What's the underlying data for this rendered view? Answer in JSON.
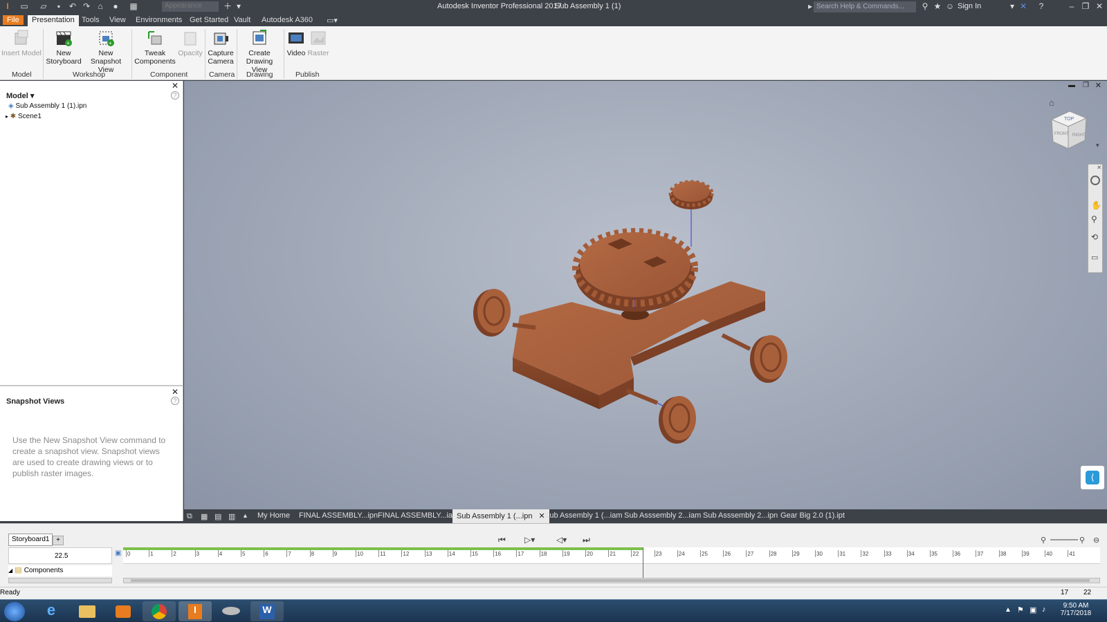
{
  "titlebar": {
    "app_title": "Autodesk Inventor Professional 2017",
    "doc_title": "Sub Assembly 1 (1)",
    "appearance": "Appearance",
    "search_placeholder": "Search Help & Commands...",
    "sign_in": "Sign In"
  },
  "menu": {
    "file": "File",
    "tabs": [
      "Presentation",
      "Tools",
      "View",
      "Environments",
      "Get Started",
      "Vault",
      "Autodesk A360"
    ]
  },
  "ribbon": {
    "buttons": [
      {
        "label1": "Insert Model",
        "label2": ""
      },
      {
        "label1": "New",
        "label2": "Storyboard"
      },
      {
        "label1": "New",
        "label2": "Snapshot View"
      },
      {
        "label1": "Tweak",
        "label2": "Components"
      },
      {
        "label1": "Opacity",
        "label2": ""
      },
      {
        "label1": "Capture",
        "label2": "Camera"
      },
      {
        "label1": "Create",
        "label2": "Drawing View"
      },
      {
        "label1": "Video",
        "label2": ""
      },
      {
        "label1": "Raster",
        "label2": ""
      }
    ],
    "groups": [
      "Model",
      "Workshop",
      "Component",
      "Camera",
      "Drawing",
      "Publish"
    ]
  },
  "model_panel": {
    "title": "Model",
    "items": [
      "Sub Assembly 1 (1).ipn",
      "Scene1"
    ]
  },
  "snapshot_panel": {
    "title": "Snapshot Views",
    "hint": "Use the New Snapshot View command to create a snapshot view. Snapshot views are used to create drawing views or to publish raster images."
  },
  "viewcube": {
    "face_top": "TOP",
    "face_front": "FRONT",
    "face_right": "RIGHT"
  },
  "doc_tabs": [
    "My Home",
    "FINAL ASSEMBLY...ipn",
    "FINAL ASSEMBLY...iam",
    "Sub Assembly 1 (...ipn",
    "Sub Assembly 1 (...iam",
    "Sub Asssembly 2...iam",
    "Sub Asssembly 2...ipn",
    "Gear Big 2.0 (1).ipt"
  ],
  "storyboard": {
    "tab": "Storyboard1",
    "time": "22.5",
    "track": "Components",
    "ticks": [
      "0",
      "1",
      "2",
      "3",
      "4",
      "5",
      "6",
      "7",
      "8",
      "9",
      "10",
      "11",
      "12",
      "13",
      "14",
      "15",
      "16",
      "17",
      "18",
      "19",
      "20",
      "21",
      "22",
      "23",
      "24",
      "25",
      "26",
      "27",
      "28",
      "29",
      "30",
      "31",
      "32",
      "33",
      "34",
      "35",
      "36",
      "37",
      "38",
      "39",
      "40",
      "41"
    ],
    "playhead_seconds": 22.5
  },
  "status": {
    "text": "Ready",
    "num1": "17",
    "num2": "22"
  },
  "taskbar": {
    "time": "9:50 AM",
    "date": "7/17/2018"
  }
}
